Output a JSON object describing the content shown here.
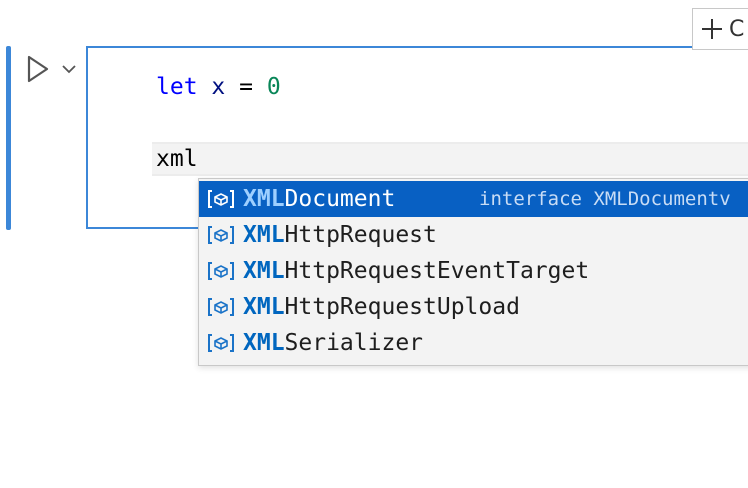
{
  "toolbar": {
    "add_label": "C"
  },
  "cell": {
    "line1": {
      "keyword": "let",
      "identifier": "x",
      "operator": "=",
      "number": "0"
    },
    "line2": "xml"
  },
  "suggestions": {
    "items": [
      {
        "match": "XML",
        "rest": "Document",
        "detail": "interface XMLDocumentv",
        "selected": true
      },
      {
        "match": "XML",
        "rest": "HttpRequest"
      },
      {
        "match": "XML",
        "rest": "HttpRequestEventTarget"
      },
      {
        "match": "XML",
        "rest": "HttpRequestUpload"
      },
      {
        "match": "XML",
        "rest": "Serializer"
      }
    ],
    "icon": "interface-symbol-icon"
  },
  "colors": {
    "accent": "#3c87d8",
    "selection": "#0860c3",
    "keyword": "#0000ff",
    "number": "#098658",
    "match": "#0066bf"
  }
}
